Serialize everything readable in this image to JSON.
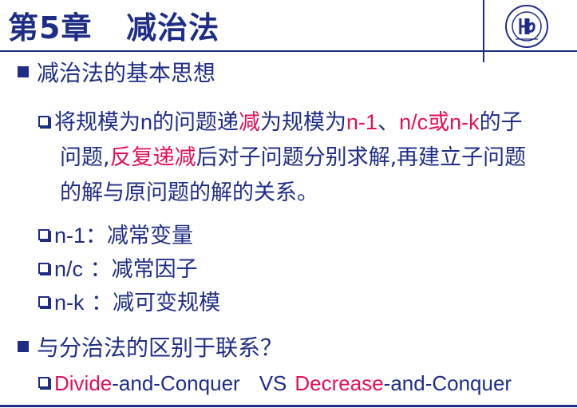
{
  "slide": {
    "title_chapter": "第5章",
    "title_name": "减治法",
    "logo": "university-seal"
  },
  "section1": {
    "heading": "减治法的基本思想",
    "para": {
      "l1": [
        "将规模为",
        "n",
        "的问题递",
        "减",
        "为规模为",
        "n-1",
        "、",
        "n/c",
        "或",
        "n-k",
        "的子"
      ],
      "l2": [
        "问题,",
        "反复递减",
        "后对子问题分别求解,再建立子问题"
      ],
      "l3": "的解与原问题的解的关系。"
    },
    "items": [
      {
        "code": "n-1",
        "sep": "：",
        "desc": "减常变量"
      },
      {
        "code": "n/c",
        "sep": " ：",
        "desc": "减常因子"
      },
      {
        "code": "n-k",
        "sep": " ：",
        "desc": "减可变规模"
      }
    ]
  },
  "section2": {
    "heading": "与分治法的区别于联系？",
    "compare": [
      "Divide",
      "-and-Conquer",
      "VS",
      "Decrease",
      "-and-Conquer"
    ]
  },
  "colors": {
    "primary": "#1f2d86",
    "accent": "#e3105a"
  }
}
